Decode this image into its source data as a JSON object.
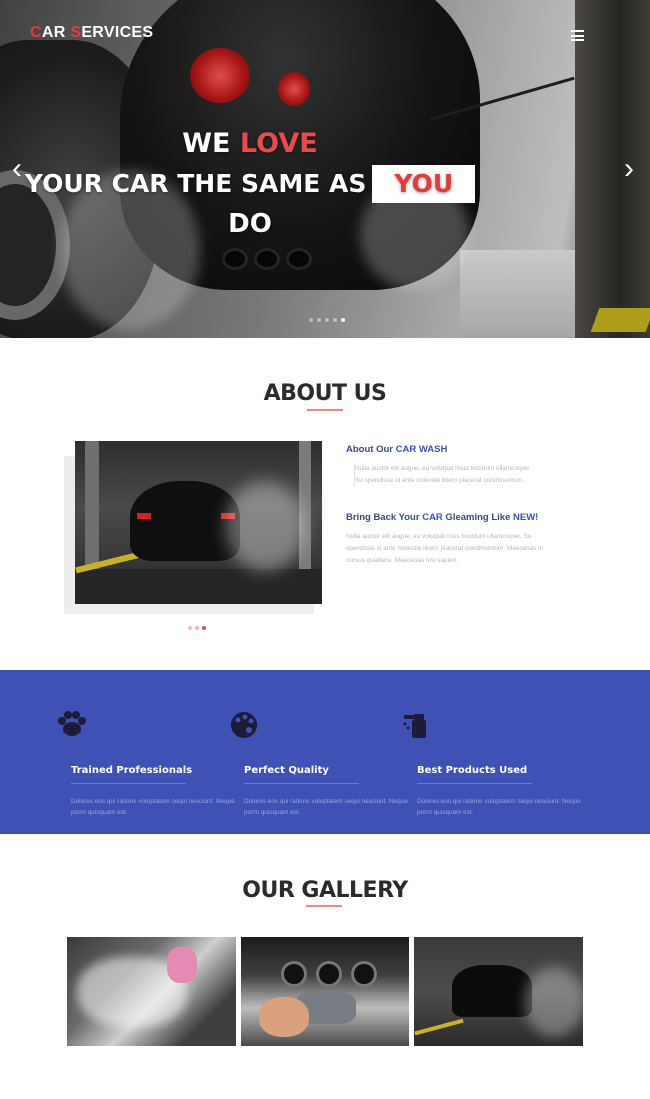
{
  "header": {
    "logo_initial_1": "C",
    "logo_rest_1": "AR ",
    "logo_initial_2": "S",
    "logo_rest_2": "ERVICES",
    "menu_icon": "hamburger-icon"
  },
  "hero": {
    "line1_white": "WE ",
    "line1_red": "LOVE",
    "line2": "YOUR CAR THE SAME AS",
    "line2_boxed": "YOU",
    "line3": "DO",
    "prev_icon": "chevron-left-icon",
    "next_icon": "chevron-right-icon",
    "slide_count": 5,
    "active_slide": 5
  },
  "about": {
    "title": "ABOUT US",
    "heading1_prefix": "About Our ",
    "heading1_accent": "CAR WASH",
    "para1": "Nulla auctor elit augue, eu volutpat risus tincidunt ullamcorper. Su spendisse id ante molestie libero placerat condimentum.",
    "heading2_prefix": "Bring Back Your ",
    "heading2_accent": "CAR",
    "heading2_middle": " Gleaming Like ",
    "heading2_accent2": "NEW!",
    "para2": "Nulla auctor elit augue, eu volutpat risus tincidunt ullamcorper. Su spendisse id ante molestie libero placerat condimentum. Maecenas in cursus qualitera. Maecenas nisi sapien."
  },
  "features": {
    "items": [
      {
        "icon": "paw-icon",
        "title": "Trained Professionals",
        "text": "Dolores eos qui ratione voluptatem sequi nesciunt. Neque porro quisquam est."
      },
      {
        "icon": "palette-icon",
        "title": "Perfect Quality",
        "text": "Dolores eos qui ratione voluptatem sequi nesciunt. Neque porro quisquam est."
      },
      {
        "icon": "spray-bottle-icon",
        "title": "Best Products Used",
        "text": "Dolores eos qui ratione voluptatem sequi nesciunt. Neque porro quisquam est."
      }
    ]
  },
  "gallery": {
    "title": "OUR GALLERY"
  },
  "colors": {
    "brand_red": "#e63b3b",
    "brand_blue": "#3f51b5"
  }
}
